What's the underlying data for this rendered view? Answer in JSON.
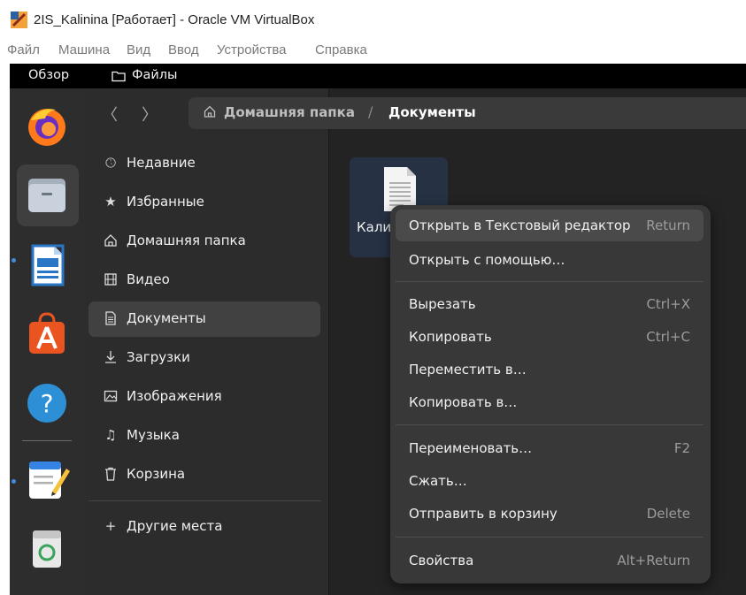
{
  "window": {
    "title": "2IS_Kalinina [Работает] - Oracle VM VirtualBox"
  },
  "vbox_menu": [
    "Файл",
    "Машина",
    "Вид",
    "Ввод",
    "Устройства",
    "Справка"
  ],
  "topbar": {
    "overview": "Обзор",
    "app_name": "Файлы"
  },
  "dock": [
    "firefox-icon",
    "files-icon",
    "writer-icon",
    "app-center-icon",
    "help-icon",
    "text-editor-icon",
    "trash-icon"
  ],
  "nav": {
    "back": "〈",
    "forward": "〉"
  },
  "path": {
    "home": "Домашняя папка",
    "separator": "/",
    "current": "Документы"
  },
  "sidebar": {
    "items": [
      {
        "label": "Недавние",
        "icon": "clock-icon"
      },
      {
        "label": "Избранные",
        "icon": "star-icon"
      },
      {
        "label": "Домашняя папка",
        "icon": "home-icon"
      },
      {
        "label": "Видео",
        "icon": "film-icon"
      },
      {
        "label": "Документы",
        "icon": "document-icon",
        "active": true
      },
      {
        "label": "Загрузки",
        "icon": "download-icon"
      },
      {
        "label": "Изображения",
        "icon": "image-icon"
      },
      {
        "label": "Музыка",
        "icon": "music-icon"
      },
      {
        "label": "Корзина",
        "icon": "trash-icon"
      }
    ],
    "other": "Другие места",
    "other_prefix": "+"
  },
  "file": {
    "name": "Кали"
  },
  "context_menu": {
    "items": [
      {
        "label": "Открыть в Текстовый редактор",
        "shortcut": "Return"
      },
      {
        "label": "Открыть с помощью…",
        "shortcut": ""
      },
      {
        "label": "Вырезать",
        "shortcut": "Ctrl+X"
      },
      {
        "label": "Копировать",
        "shortcut": "Ctrl+C"
      },
      {
        "label": "Переместить в…",
        "shortcut": ""
      },
      {
        "label": "Копировать в…",
        "shortcut": ""
      },
      {
        "label": "Переименовать…",
        "shortcut": "F2"
      },
      {
        "label": "Сжать…",
        "shortcut": ""
      },
      {
        "label": "Отправить в корзину",
        "shortcut": "Delete"
      },
      {
        "label": "Свойства",
        "shortcut": "Alt+Return"
      }
    ]
  },
  "colors": {
    "accent": "#3f8ae0",
    "menu_bg": "#383838",
    "selection": "#263244"
  }
}
